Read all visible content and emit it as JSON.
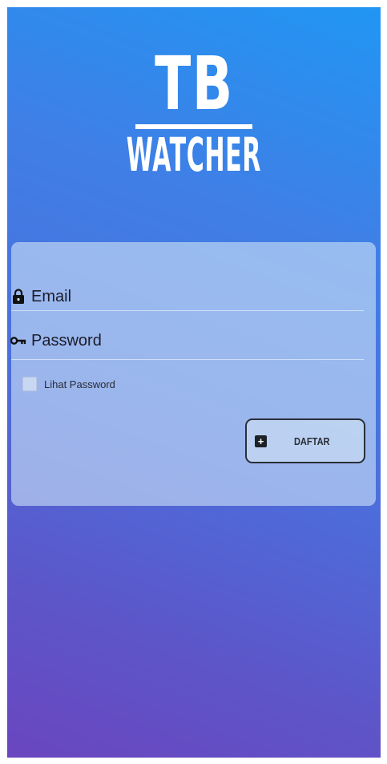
{
  "logo": {
    "line1": "TB",
    "line2": "WATCHER"
  },
  "form": {
    "email_placeholder": "Email",
    "password_placeholder": "Password",
    "show_password_label": "Lihat Password",
    "show_password_checked": false,
    "register_button_label": "DAFTAR"
  },
  "icons": {
    "email": "lock-icon",
    "password": "key-icon",
    "register": "plus-box-icon"
  }
}
